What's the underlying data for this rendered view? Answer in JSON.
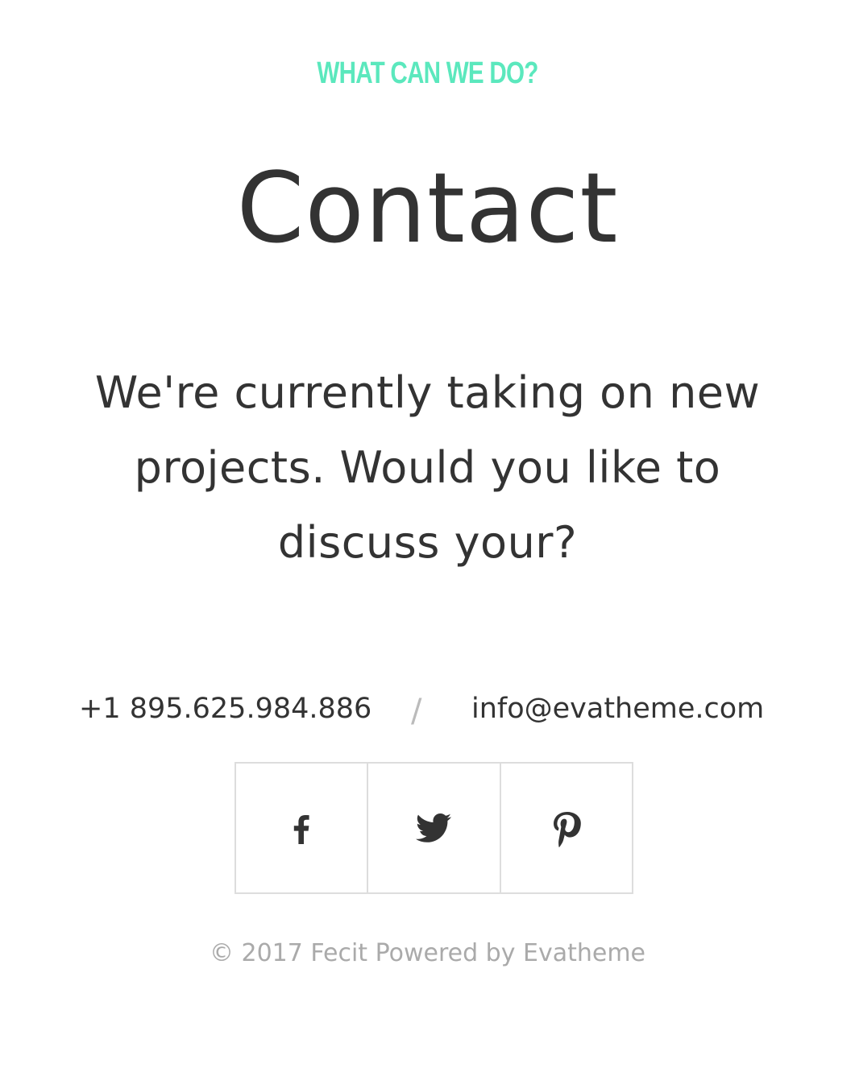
{
  "section": {
    "eyebrow": "WHAT CAN WE DO?",
    "title": "Contact",
    "lead": "We're currently taking on new projects. Would you like to discuss your?"
  },
  "contact": {
    "phone": "+1 895.625.984.886",
    "separator": "/",
    "email": "info@evatheme.com"
  },
  "social": [
    {
      "name": "facebook",
      "icon": "facebook-icon"
    },
    {
      "name": "twitter",
      "icon": "twitter-icon"
    },
    {
      "name": "pinterest",
      "icon": "pinterest-icon"
    }
  ],
  "footer": {
    "copyright": "© 2017 Fecit Powered by Evatheme"
  },
  "colors": {
    "accent": "#5be8bd",
    "text": "#333333",
    "muted": "#aaaaaa",
    "border": "#dddddd"
  }
}
